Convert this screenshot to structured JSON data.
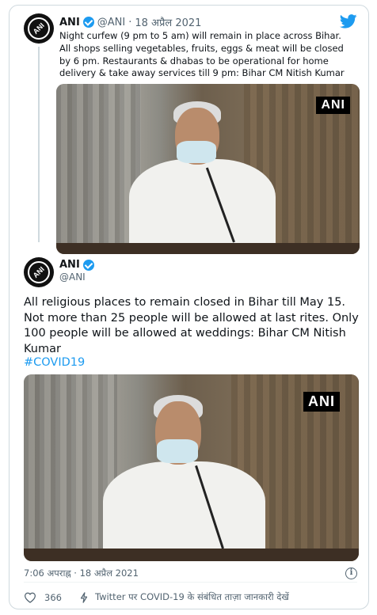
{
  "quoted": {
    "name": "ANI",
    "handle": "@ANI",
    "separator": "·",
    "date": "18 अप्रैल 2021",
    "text": "Night curfew (9 pm to 5 am) will remain in place across Bihar. All shops selling vegetables, fruits, eggs & meat will be closed by 6 pm. Restaurants & dhabas to be operational for home delivery & take away services till 9 pm: Bihar CM Nitish Kumar",
    "photo_watermark": "ANI"
  },
  "tweet": {
    "name": "ANI",
    "handle": "@ANI",
    "text": "All religious places to remain closed in Bihar till May 15. Not more than 25 people will be allowed at last rites. Only 100 people will be allowed at weddings: Bihar CM Nitish Kumar",
    "hashtag": "#COVID19",
    "photo_watermark": "ANI",
    "timestamp": "7:06 अपराह्न · 18 अप्रैल 2021",
    "likes": "366",
    "topic_link": "Twitter पर COVID-19 के संबंधित ताज़ा जानकारी देखें"
  },
  "logo_text": "ANI",
  "icons": {
    "platform": "twitter-bird-icon",
    "verified": "verified-badge-icon",
    "like": "heart-icon",
    "topic": "lightning-bolt-icon",
    "info": "info-icon"
  },
  "colors": {
    "accent": "#1d9bf0",
    "text": "#0f1419",
    "muted": "#536471",
    "border": "#cfd9de"
  }
}
